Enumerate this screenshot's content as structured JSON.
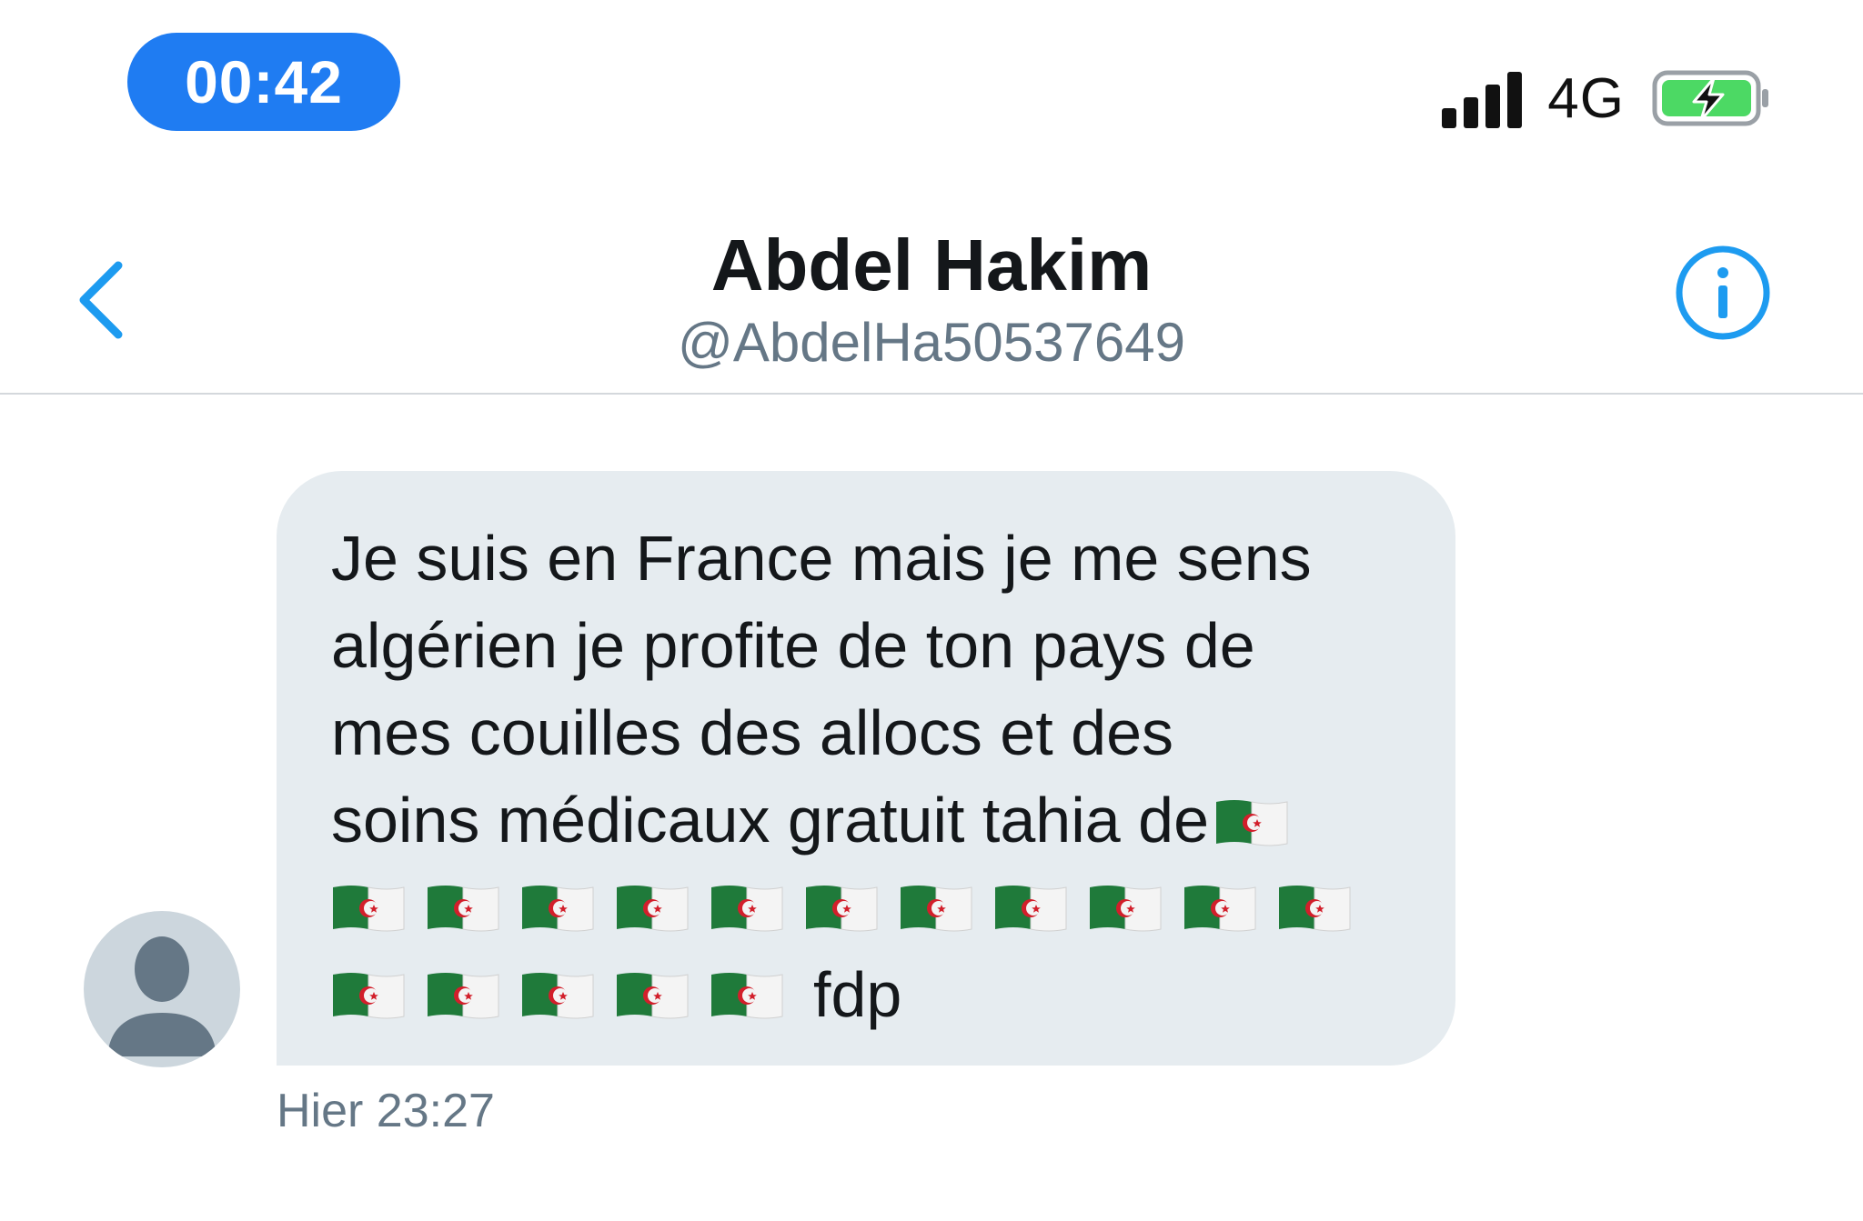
{
  "status_bar": {
    "time": "00:42",
    "network": "4G",
    "battery_charging": true,
    "signal_bars": 4
  },
  "header": {
    "name": "Abdel Hakim",
    "handle": "@AbdelHa50537649",
    "accent_color": "#1d9bf0"
  },
  "conversation": {
    "message": {
      "text": "Je suis en France mais je me sens\nalgérien je profite de ton pays de\nmes couilles des allocs et des\nsoins médicaux gratuit tahia de",
      "emoji_name": "flag-algeria-icon",
      "flags_line_one": 11,
      "flags_line_two": 5,
      "tail_text": "fdp"
    },
    "timestamp": "Hier 23:27"
  }
}
